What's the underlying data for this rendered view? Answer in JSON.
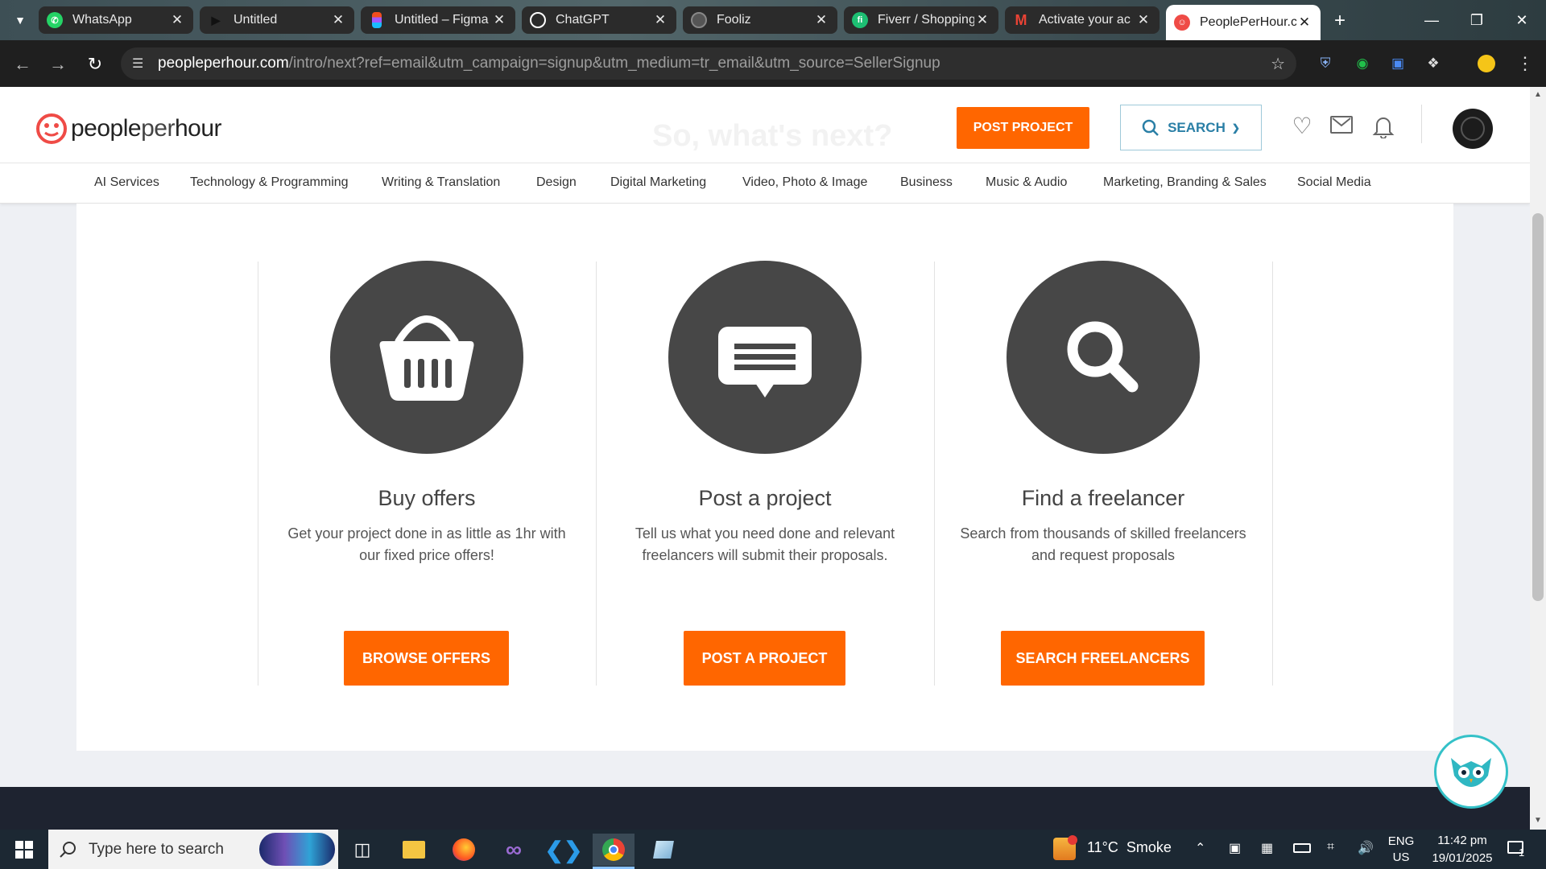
{
  "browser": {
    "tabs": [
      {
        "label": "WhatsApp",
        "icon": "whatsapp-icon",
        "color": "#25d366"
      },
      {
        "label": "Untitled",
        "icon": "play-icon",
        "color": "#222222"
      },
      {
        "label": "Untitled – Figma",
        "icon": "figma-icon",
        "color": "#a259ff"
      },
      {
        "label": "ChatGPT",
        "icon": "openai-icon",
        "color": "#ffffff"
      },
      {
        "label": "Fooliz",
        "icon": "globe-icon",
        "color": "#888888"
      },
      {
        "label": "Fiverr / Shopping",
        "icon": "fiverr-icon",
        "color": "#1dbf73"
      },
      {
        "label": "Activate your ac",
        "icon": "gmail-icon",
        "color": "#ea4335"
      },
      {
        "label": "PeoplePerHour.c",
        "icon": "pph-icon",
        "color": "#ef4b46"
      }
    ],
    "new_tab": "+",
    "url_host": "peopleperhour.com",
    "url_path": "/intro/next?ref=email&utm_campaign=signup&utm_medium=tr_email&utm_source=SellerSignup"
  },
  "site": {
    "logo_bold": "people",
    "logo_light": "per",
    "logo_end": "hour",
    "post_project_button": "POST PROJECT",
    "search_button": "SEARCH",
    "faded_heading": "So, what's next?",
    "categories": [
      "AI Services",
      "Technology & Programming",
      "Writing & Translation",
      "Design",
      "Digital Marketing",
      "Video, Photo & Image",
      "Business",
      "Music & Audio",
      "Marketing, Branding & Sales",
      "Social Media"
    ],
    "features": [
      {
        "title": "Buy offers",
        "desc1": "Get your project done in as little as 1hr with",
        "desc2": "our fixed price offers!",
        "button": "BROWSE OFFERS",
        "icon": "basket-icon"
      },
      {
        "title": "Post a project",
        "desc1": "Tell us what you need done and relevant",
        "desc2": "freelancers will submit their proposals.",
        "button": "POST A PROJECT",
        "icon": "chat-bubble-icon"
      },
      {
        "title": "Find a freelancer",
        "desc1": "Search from thousands of skilled freelancers",
        "desc2": "and request proposals",
        "button": "SEARCH FREELANCERS",
        "icon": "magnifier-icon"
      }
    ],
    "accent_color": "#ff6600"
  },
  "taskbar": {
    "search_placeholder": "Type here to search",
    "weather": "11°C  Smoke",
    "lang1": "ENG",
    "lang2": "US",
    "time": "11:42 pm",
    "date": "19/01/2025",
    "notification_count": "1"
  }
}
